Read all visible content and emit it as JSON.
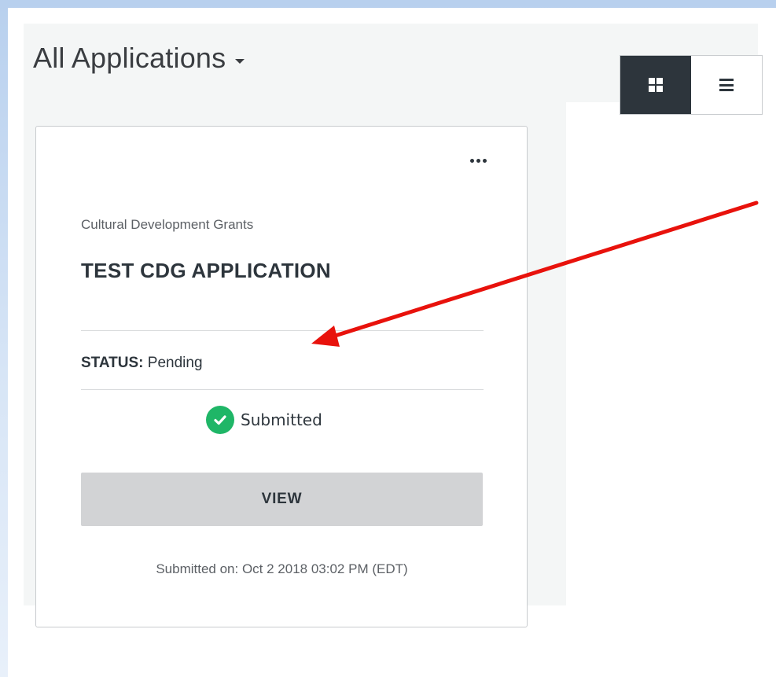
{
  "header": {
    "title": "All Applications",
    "view_toggle": {
      "grid_icon": "grid-icon",
      "list_icon": "list-icon",
      "active": "grid"
    }
  },
  "card": {
    "menu_icon": "more-icon",
    "program": "Cultural Development Grants",
    "title": "TEST CDG APPLICATION",
    "status_label": "STATUS:",
    "status_value": "Pending",
    "badge": {
      "icon": "check-circle-icon",
      "label": "Submitted",
      "color": "#1fb667"
    },
    "view_button": "VIEW",
    "submitted_on": "Submitted on: Oct 2 2018 03:02 PM (EDT)"
  },
  "annotation": {
    "type": "arrow",
    "color": "#e8120c"
  }
}
